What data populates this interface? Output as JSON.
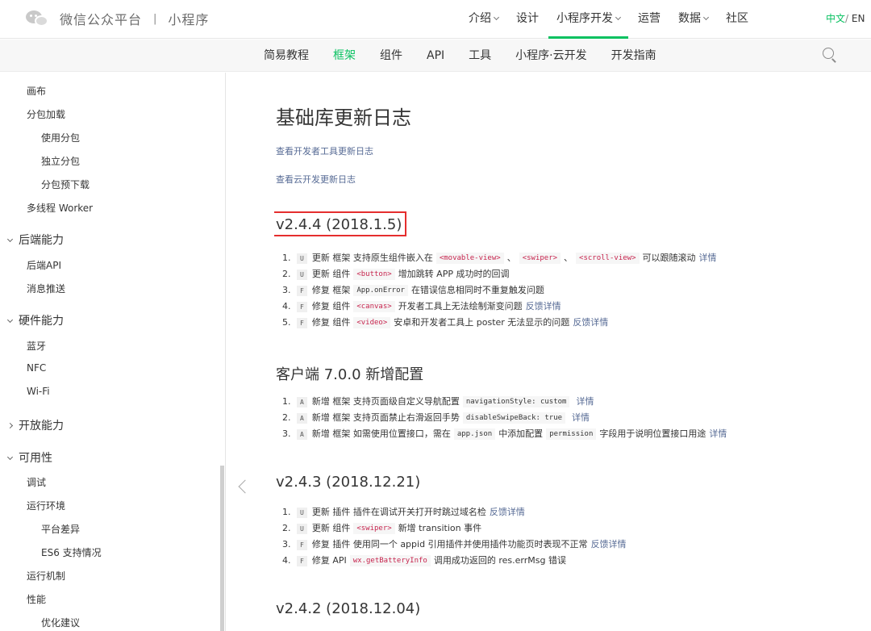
{
  "header": {
    "brand": "微信公众平台",
    "separator": "|",
    "product": "小程序",
    "nav": [
      {
        "label": "介绍",
        "dropdown": true,
        "active": false
      },
      {
        "label": "设计",
        "dropdown": false,
        "active": false
      },
      {
        "label": "小程序开发",
        "dropdown": true,
        "active": true
      },
      {
        "label": "运营",
        "dropdown": false,
        "active": false
      },
      {
        "label": "数据",
        "dropdown": true,
        "active": false
      },
      {
        "label": "社区",
        "dropdown": false,
        "active": false
      }
    ],
    "lang_zh": "中文",
    "lang_slash": "/",
    "lang_en": "EN"
  },
  "subnav": {
    "items": [
      "简易教程",
      "框架",
      "组件",
      "API",
      "工具",
      "小程序·云开发",
      "开发指南"
    ],
    "active_index": 1
  },
  "sidebar": {
    "items": [
      {
        "label": "画布",
        "level": 2
      },
      {
        "label": "分包加载",
        "level": 2
      },
      {
        "label": "使用分包",
        "level": 3
      },
      {
        "label": "独立分包",
        "level": 3
      },
      {
        "label": "分包预下载",
        "level": 3
      },
      {
        "label": "多线程 Worker",
        "level": 2
      },
      {
        "label": "后端能力",
        "level": 1,
        "chevron": "down"
      },
      {
        "label": "后端API",
        "level": 2
      },
      {
        "label": "消息推送",
        "level": 2
      },
      {
        "label": "硬件能力",
        "level": 1,
        "chevron": "down"
      },
      {
        "label": "蓝牙",
        "level": 2
      },
      {
        "label": "NFC",
        "level": 2
      },
      {
        "label": "Wi-Fi",
        "level": 2
      },
      {
        "label": "开放能力",
        "level": 1,
        "chevron": "right"
      },
      {
        "label": "可用性",
        "level": 1,
        "chevron": "down"
      },
      {
        "label": "调试",
        "level": 2
      },
      {
        "label": "运行环境",
        "level": 2
      },
      {
        "label": "平台差异",
        "level": 3
      },
      {
        "label": "ES6 支持情况",
        "level": 3
      },
      {
        "label": "运行机制",
        "level": 2
      },
      {
        "label": "性能",
        "level": 2
      },
      {
        "label": "优化建议",
        "level": 3
      }
    ]
  },
  "main": {
    "title": "基础库更新日志",
    "links": [
      "查看开发者工具更新日志",
      "查看云开发更新日志"
    ],
    "sections": [
      {
        "title": "v2.4.4 (2018.1.5)",
        "highlighted": true,
        "items": [
          {
            "num": "1.",
            "badge": "U",
            "parts": [
              {
                "t": "text",
                "v": "更新 框架 支持原生组件嵌入在"
              },
              {
                "t": "code",
                "v": "<movable-view>"
              },
              {
                "t": "text",
                "v": "、"
              },
              {
                "t": "code",
                "v": "<swiper>"
              },
              {
                "t": "text",
                "v": "、"
              },
              {
                "t": "code",
                "v": "<scroll-view>"
              },
              {
                "t": "text",
                "v": "可以跟随滚动"
              },
              {
                "t": "link",
                "v": "详情"
              }
            ]
          },
          {
            "num": "2.",
            "badge": "U",
            "parts": [
              {
                "t": "text",
                "v": "更新 组件"
              },
              {
                "t": "code",
                "v": "<button>"
              },
              {
                "t": "text",
                "v": "增加跳转 APP 成功时的回调"
              }
            ]
          },
          {
            "num": "3.",
            "badge": "F",
            "parts": [
              {
                "t": "text",
                "v": "修复 框架"
              },
              {
                "t": "codeplain",
                "v": "App.onError"
              },
              {
                "t": "text",
                "v": "在错误信息相同时不重复触发问题"
              }
            ]
          },
          {
            "num": "4.",
            "badge": "F",
            "parts": [
              {
                "t": "text",
                "v": "修复 组件"
              },
              {
                "t": "code",
                "v": "<canvas>"
              },
              {
                "t": "text",
                "v": "开发者工具上无法绘制渐变问题"
              },
              {
                "t": "link",
                "v": "反馈详情"
              }
            ]
          },
          {
            "num": "5.",
            "badge": "F",
            "parts": [
              {
                "t": "text",
                "v": "修复 组件"
              },
              {
                "t": "code",
                "v": "<video>"
              },
              {
                "t": "text",
                "v": "安卓和开发者工具上 poster 无法显示的问题"
              },
              {
                "t": "link",
                "v": "反馈详情"
              }
            ]
          }
        ]
      },
      {
        "title": "客户端 7.0.0 新增配置",
        "highlighted": false,
        "items": [
          {
            "num": "1.",
            "badge": "A",
            "parts": [
              {
                "t": "text",
                "v": "新增 框架 支持页面级自定义导航配置"
              },
              {
                "t": "codeplain",
                "v": "navigationStyle: custom"
              },
              {
                "t": "link",
                "v": "详情"
              }
            ]
          },
          {
            "num": "2.",
            "badge": "A",
            "parts": [
              {
                "t": "text",
                "v": "新增 框架 支持页面禁止右滑返回手势"
              },
              {
                "t": "codeplain",
                "v": "disableSwipeBack: true"
              },
              {
                "t": "link",
                "v": "详情"
              }
            ]
          },
          {
            "num": "3.",
            "badge": "A",
            "parts": [
              {
                "t": "text",
                "v": "新增 框架 如需使用位置接口，需在"
              },
              {
                "t": "codeplain",
                "v": "app.json"
              },
              {
                "t": "text",
                "v": "中添加配置"
              },
              {
                "t": "codeplain",
                "v": "permission"
              },
              {
                "t": "text",
                "v": "字段用于说明位置接口用途"
              },
              {
                "t": "link",
                "v": "详情"
              }
            ]
          }
        ]
      },
      {
        "title": "v2.4.3 (2018.12.21)",
        "highlighted": false,
        "items": [
          {
            "num": "1.",
            "badge": "U",
            "parts": [
              {
                "t": "text",
                "v": "更新 插件 插件在调试开关打开时跳过域名检"
              },
              {
                "t": "link",
                "v": "反馈详情"
              }
            ]
          },
          {
            "num": "2.",
            "badge": "U",
            "parts": [
              {
                "t": "text",
                "v": "更新 组件"
              },
              {
                "t": "code",
                "v": "<swiper>"
              },
              {
                "t": "text",
                "v": "新增 transition 事件"
              }
            ]
          },
          {
            "num": "3.",
            "badge": "F",
            "parts": [
              {
                "t": "text",
                "v": "修复 插件 使用同一个 appid 引用插件并使用插件功能页时表现不正常"
              },
              {
                "t": "link",
                "v": "反馈详情"
              }
            ]
          },
          {
            "num": "4.",
            "badge": "F",
            "parts": [
              {
                "t": "text",
                "v": "修复 API"
              },
              {
                "t": "code",
                "v": "wx.getBatteryInfo"
              },
              {
                "t": "text",
                "v": "调用成功返回的 res.errMsg 错误"
              }
            ]
          }
        ]
      },
      {
        "title": "v2.4.2 (2018.12.04)",
        "highlighted": false,
        "items": []
      }
    ]
  },
  "colors": {
    "accent": "#07c160",
    "link": "#576b95",
    "highlight_border": "#e52e2e"
  }
}
